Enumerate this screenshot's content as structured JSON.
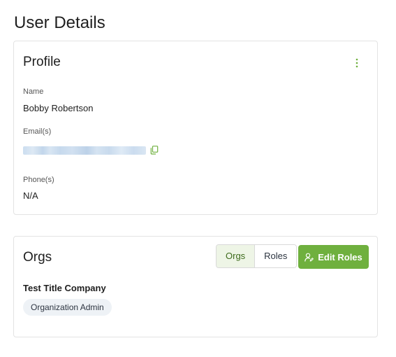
{
  "page": {
    "title": "User Details"
  },
  "profile": {
    "title": "Profile",
    "menu_icon": "kebab-vertical-icon",
    "name_label": "Name",
    "name_value": "Bobby Robertson",
    "email_label": "Email(s)",
    "email_value_redacted": "",
    "copy_icon": "copy-icon",
    "phone_label": "Phone(s)",
    "phone_value": "N/A"
  },
  "orgs": {
    "title": "Orgs",
    "tabs": [
      {
        "label": "Orgs",
        "active": true
      },
      {
        "label": "Roles",
        "active": false
      }
    ],
    "edit_button": {
      "label": "Edit Roles",
      "icon": "user-edit-icon"
    },
    "items": [
      {
        "org_name": "Test Title Company",
        "role": "Organization Admin"
      }
    ]
  },
  "colors": {
    "accent": "#6fb03e",
    "active_tab_bg": "#eef5e6",
    "active_tab_text": "#3e6b1c",
    "chip_bg": "#eef2f6",
    "card_border": "#e3e3e3"
  }
}
